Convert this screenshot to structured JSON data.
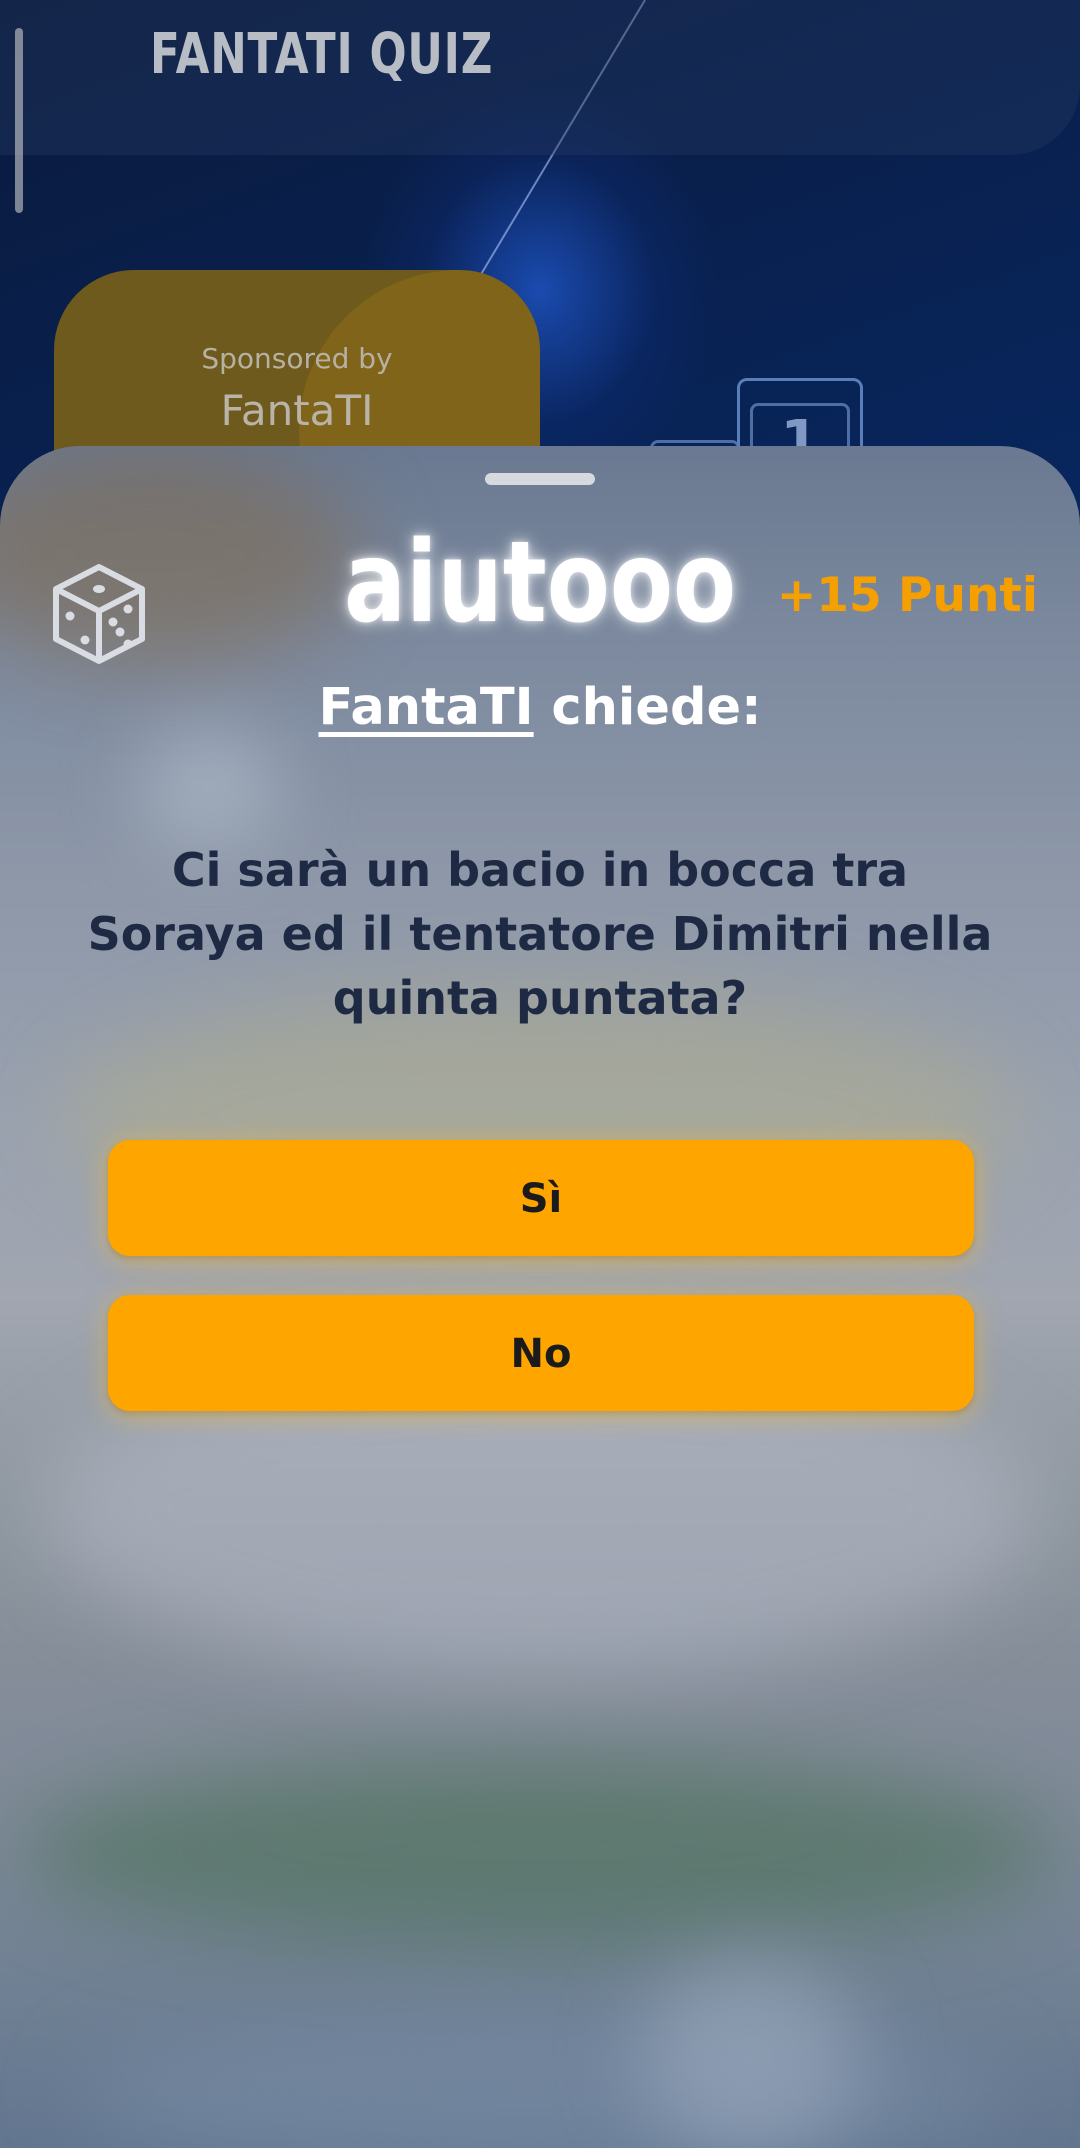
{
  "app": {
    "title": "FANTATI QUIZ"
  },
  "sponsor": {
    "label": "Sponsored by",
    "name": "FantaTI"
  },
  "rank": {
    "number": "1"
  },
  "sheet": {
    "icon": "dice-icon",
    "title": "aiutooo",
    "points": "+15 Punti",
    "asker_name": "FantaTI",
    "asker_suffix": " chiede:",
    "question": "Ci sarà un bacio in bocca tra Soraya ed il tentatore Dimitri nella quinta puntata?",
    "answers": [
      {
        "label": "Sì"
      },
      {
        "label": "No"
      }
    ]
  },
  "colors": {
    "accent": "#ffa500",
    "points": "#f5a000",
    "question_text": "#1e2a44"
  }
}
